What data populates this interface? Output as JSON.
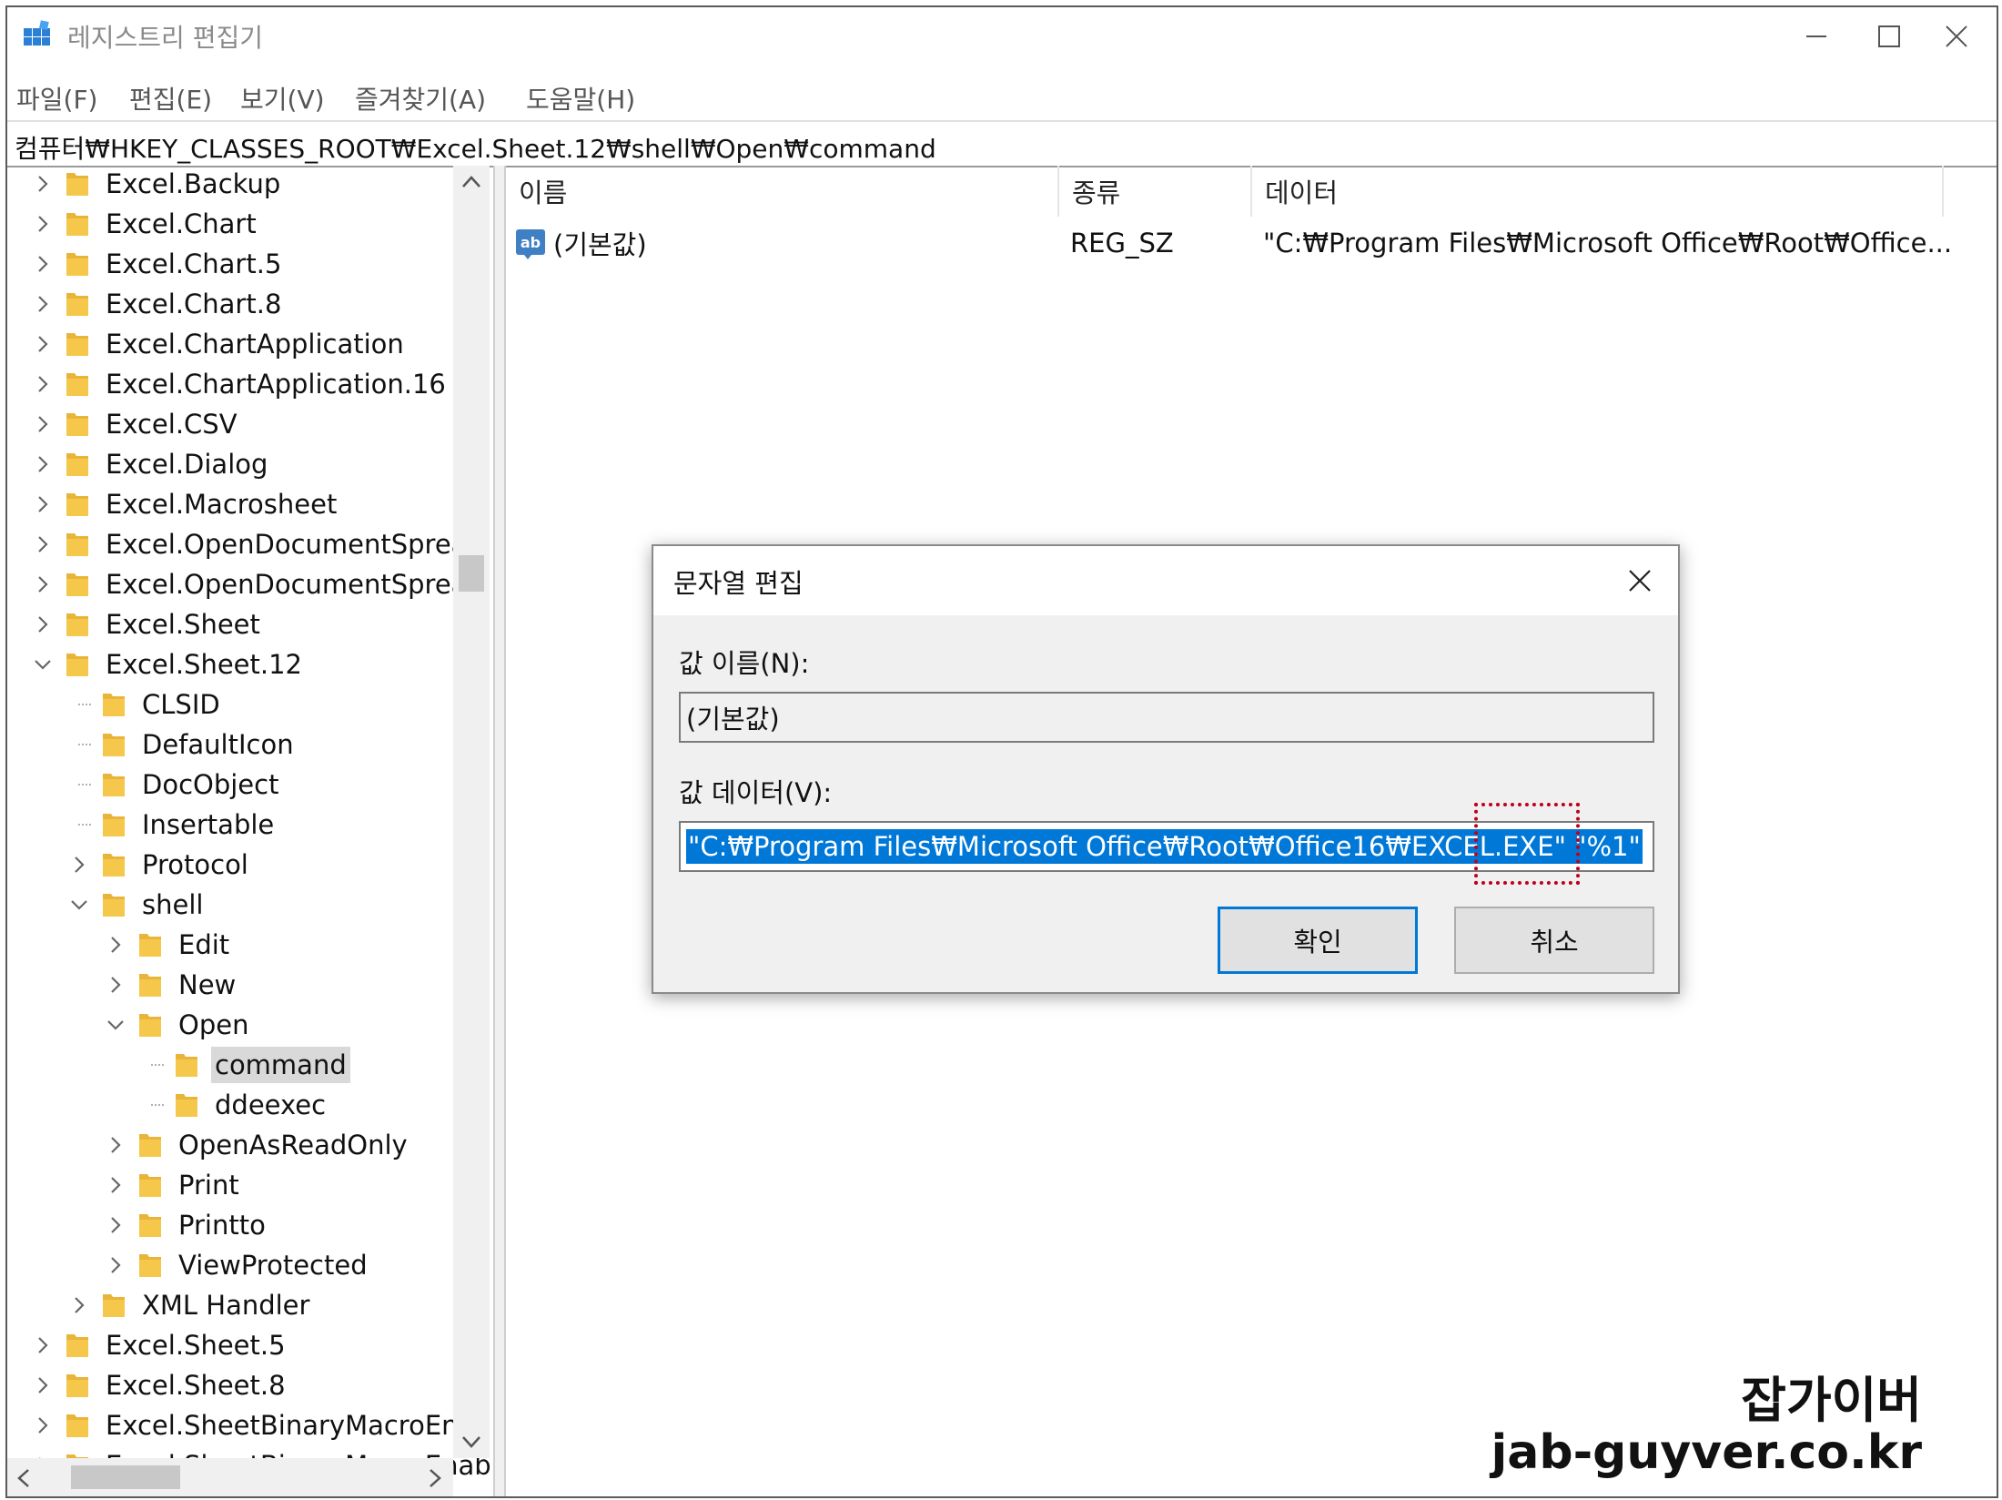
{
  "window": {
    "title": "레지스트리 편집기",
    "app_icon": "registry-editor-icon"
  },
  "menu": [
    "파일(F)",
    "편집(E)",
    "보기(V)",
    "즐겨찾기(A)",
    "도움말(H)"
  ],
  "address": "컴퓨터₩HKEY_CLASSES_ROOT₩Excel.Sheet.12₩shell₩Open₩command",
  "tree": [
    {
      "label": "Excel.Backup",
      "level": 0,
      "chevron": "right"
    },
    {
      "label": "Excel.Chart",
      "level": 0,
      "chevron": "right"
    },
    {
      "label": "Excel.Chart.5",
      "level": 0,
      "chevron": "right"
    },
    {
      "label": "Excel.Chart.8",
      "level": 0,
      "chevron": "right"
    },
    {
      "label": "Excel.ChartApplication",
      "level": 0,
      "chevron": "right"
    },
    {
      "label": "Excel.ChartApplication.16",
      "level": 0,
      "chevron": "right"
    },
    {
      "label": "Excel.CSV",
      "level": 0,
      "chevron": "right"
    },
    {
      "label": "Excel.Dialog",
      "level": 0,
      "chevron": "right"
    },
    {
      "label": "Excel.Macrosheet",
      "level": 0,
      "chevron": "right"
    },
    {
      "label": "Excel.OpenDocumentSpread",
      "level": 0,
      "chevron": "right"
    },
    {
      "label": "Excel.OpenDocumentSpread",
      "level": 0,
      "chevron": "right"
    },
    {
      "label": "Excel.Sheet",
      "level": 0,
      "chevron": "right"
    },
    {
      "label": "Excel.Sheet.12",
      "level": 0,
      "chevron": "down"
    },
    {
      "label": "CLSID",
      "level": 1,
      "chevron": "none"
    },
    {
      "label": "DefaultIcon",
      "level": 1,
      "chevron": "none"
    },
    {
      "label": "DocObject",
      "level": 1,
      "chevron": "none"
    },
    {
      "label": "Insertable",
      "level": 1,
      "chevron": "none"
    },
    {
      "label": "Protocol",
      "level": 1,
      "chevron": "right"
    },
    {
      "label": "shell",
      "level": 1,
      "chevron": "down"
    },
    {
      "label": "Edit",
      "level": 2,
      "chevron": "right"
    },
    {
      "label": "New",
      "level": 2,
      "chevron": "right"
    },
    {
      "label": "Open",
      "level": 2,
      "chevron": "down"
    },
    {
      "label": "command",
      "level": 3,
      "chevron": "none",
      "selected": true
    },
    {
      "label": "ddeexec",
      "level": 3,
      "chevron": "none"
    },
    {
      "label": "OpenAsReadOnly",
      "level": 2,
      "chevron": "right"
    },
    {
      "label": "Print",
      "level": 2,
      "chevron": "right"
    },
    {
      "label": "Printto",
      "level": 2,
      "chevron": "right"
    },
    {
      "label": "ViewProtected",
      "level": 2,
      "chevron": "right"
    },
    {
      "label": "XML Handler",
      "level": 1,
      "chevron": "right"
    },
    {
      "label": "Excel.Sheet.5",
      "level": 0,
      "chevron": "right"
    },
    {
      "label": "Excel.Sheet.8",
      "level": 0,
      "chevron": "right"
    },
    {
      "label": "Excel.SheetBinaryMacroEnab",
      "level": 0,
      "chevron": "right"
    },
    {
      "label": "Excel.SheetBinaryMacroEnab",
      "level": 0,
      "chevron": "right"
    }
  ],
  "list": {
    "headers": {
      "name": "이름",
      "type": "종류",
      "data": "데이터"
    },
    "rows": [
      {
        "icon": "string-value-icon",
        "icon_text": "ab",
        "name": "(기본값)",
        "type": "REG_SZ",
        "data": "\"C:₩Program Files₩Microsoft Office₩Root₩Office..."
      }
    ]
  },
  "dialog": {
    "title": "문자열 편집",
    "value_name_label": "값 이름(N):",
    "value_name": "(기본값)",
    "value_data_label": "값 데이터(V):",
    "value_data": "\"C:₩Program Files₩Microsoft Office₩Root₩Office16₩EXCEL.EXE\" \"%1\"",
    "ok_label": "확인",
    "cancel_label": "취소"
  },
  "watermark": {
    "line1": "잡가이버",
    "line2": "jab-guyver.co.kr"
  },
  "colors": {
    "selection": "#0078d7",
    "folder": "#f5c84c",
    "highlight": "#c0001a"
  }
}
